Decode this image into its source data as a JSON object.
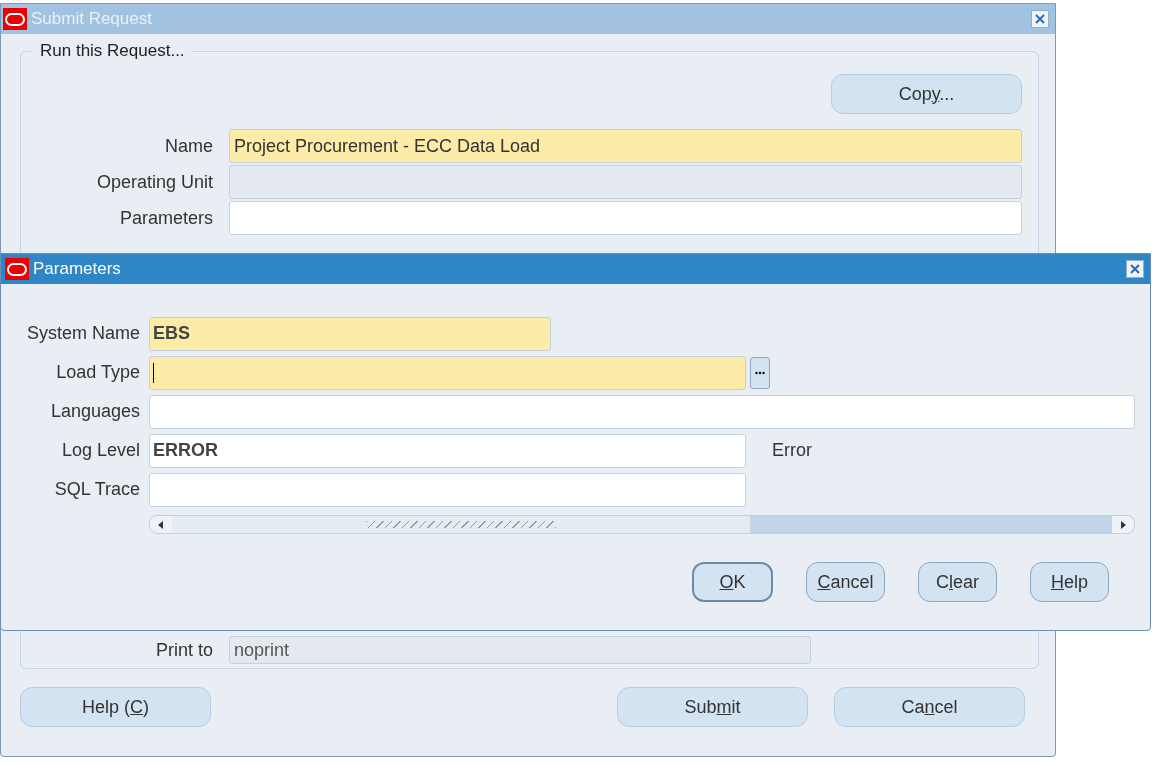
{
  "submit_window": {
    "title": "Submit Request",
    "group_title": "Run this Request...",
    "copy_button": {
      "label": {
        "before": "Cop",
        "key": "y",
        "after": "..."
      }
    },
    "fields": [
      {
        "label": "Name",
        "value": "Project Procurement - ECC Data Load",
        "kind": "required"
      },
      {
        "label": "Operating Unit",
        "kind": "readonly"
      },
      {
        "label": "Parameters",
        "kind": "normal"
      }
    ],
    "print_row": {
      "label": "Print to",
      "value": "noprint"
    },
    "buttons": [
      {
        "label": {
          "before": "Help (",
          "key": "C",
          "after": ")"
        }
      },
      {
        "label": {
          "before": "Sub",
          "key": "m",
          "after": "it"
        }
      },
      {
        "label": {
          "before": "Ca",
          "key": "n",
          "after": "cel"
        }
      }
    ]
  },
  "parameters_window": {
    "title": "Parameters",
    "fields": [
      {
        "label": "System Name",
        "value": "EBS",
        "kind": "required"
      },
      {
        "label": "Load Type",
        "kind": "required",
        "lov": true,
        "focused": true
      },
      {
        "label": "Languages",
        "kind": "normal"
      },
      {
        "label": "Log Level",
        "value": "ERROR",
        "kind": "normal",
        "note": "Error"
      },
      {
        "label": "SQL Trace",
        "kind": "normal"
      }
    ],
    "buttons": [
      {
        "label": {
          "key": "O",
          "after": "K"
        },
        "selected": true
      },
      {
        "label": {
          "key": "C",
          "after": "ancel"
        },
        "selected": false
      },
      {
        "label": {
          "before": "C",
          "key": "l",
          "after": "ear"
        },
        "selected": false
      },
      {
        "label": {
          "key": "H",
          "after": "elp"
        },
        "selected": false
      }
    ]
  }
}
